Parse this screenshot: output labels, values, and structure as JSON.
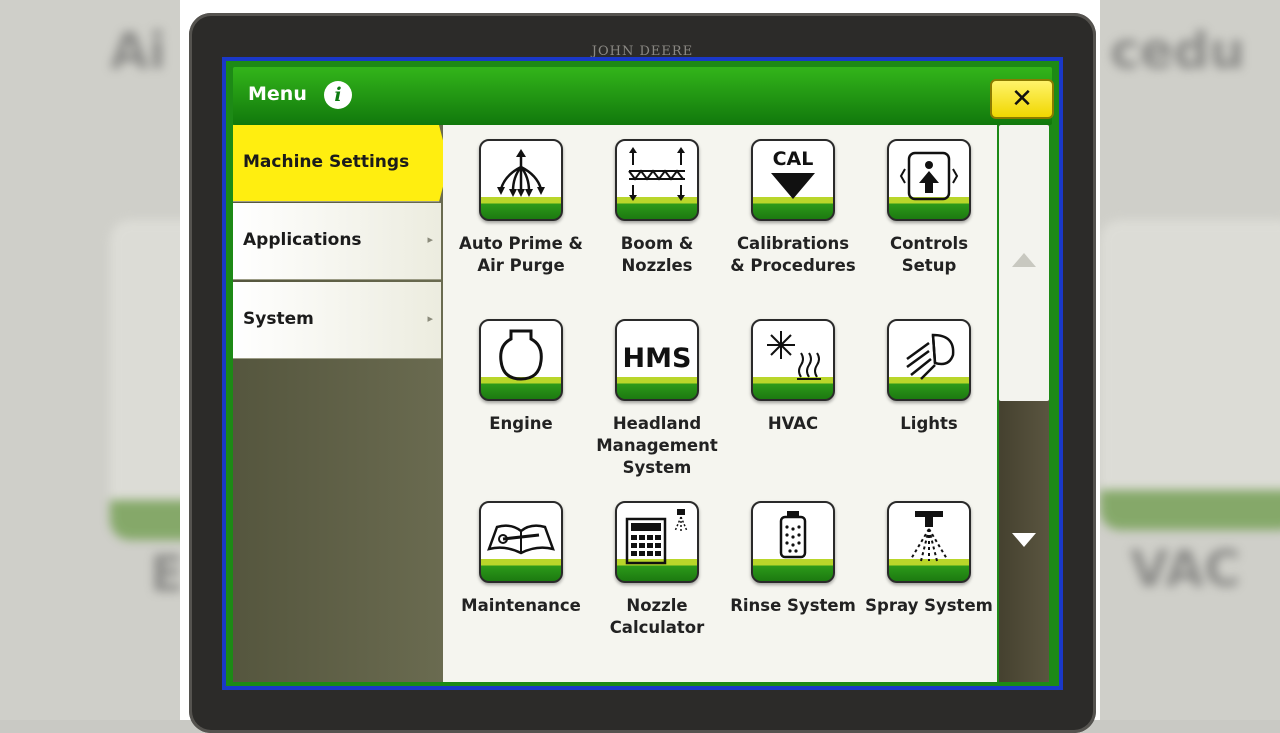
{
  "device": {
    "brand": "JOHN DEERE"
  },
  "header": {
    "title": "Menu",
    "info_icon": "i",
    "close_label": "✕"
  },
  "nav": {
    "items": [
      {
        "label": "Machine Settings",
        "active": true,
        "arrow": ""
      },
      {
        "label": "Applications",
        "active": false,
        "arrow": "▸"
      },
      {
        "label": "System",
        "active": false,
        "arrow": "▸"
      }
    ]
  },
  "tiles": [
    {
      "icon": "branching-arrows-icon",
      "lines": [
        "Auto Prime &",
        "Air Purge"
      ]
    },
    {
      "icon": "boom-nozzles-icon",
      "lines": [
        "Boom &",
        "Nozzles"
      ]
    },
    {
      "icon": "cal-arrow-icon",
      "icon_text": "CAL",
      "lines": [
        "Calibrations",
        "& Procedures"
      ]
    },
    {
      "icon": "controls-setup-icon",
      "lines": [
        "Controls",
        "Setup"
      ]
    },
    {
      "icon": "engine-icon",
      "lines": [
        "Engine"
      ]
    },
    {
      "icon": "hms-icon",
      "icon_text": "HMS",
      "lines": [
        "Headland",
        "Management",
        "System"
      ]
    },
    {
      "icon": "hvac-icon",
      "lines": [
        "HVAC"
      ]
    },
    {
      "icon": "lights-icon",
      "lines": [
        "Lights"
      ]
    },
    {
      "icon": "maintenance-book-icon",
      "lines": [
        "Maintenance"
      ]
    },
    {
      "icon": "nozzle-calculator-icon",
      "lines": [
        "Nozzle",
        "Calculator"
      ]
    },
    {
      "icon": "rinse-system-icon",
      "lines": [
        "Rinse System"
      ]
    },
    {
      "icon": "spray-system-icon",
      "lines": [
        "Spray System"
      ]
    }
  ],
  "scrollbar": {
    "up_icon": "scroll-up-arrow-icon",
    "down_icon": "scroll-down-arrow-icon"
  }
}
